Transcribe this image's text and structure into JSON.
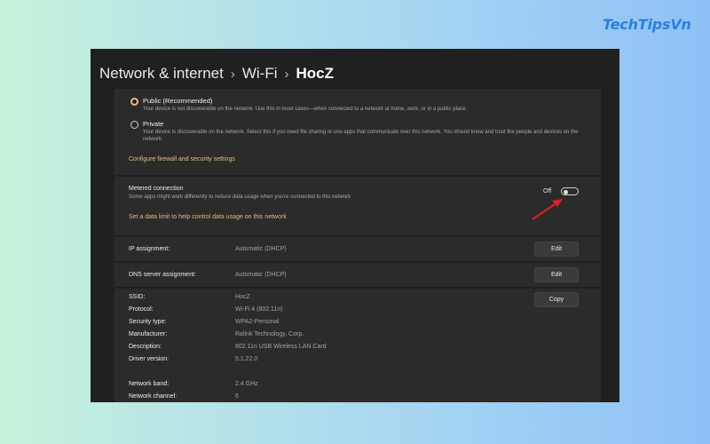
{
  "watermark": "TechTipsVn",
  "breadcrumb": {
    "items": [
      "Network & internet",
      "Wi-Fi",
      "HocZ"
    ],
    "separator": "›"
  },
  "network_profile": {
    "options": [
      {
        "title": "Public (Recommended)",
        "description": "Your device is not discoverable on the network. Use this in most cases—when connected to a network at home, work, or in a public place.",
        "selected": true
      },
      {
        "title": "Private",
        "description": "Your device is discoverable on the network. Select this if you need file sharing or use apps that communicate over this network. You should know and trust the people and devices on the network.",
        "selected": false
      }
    ],
    "firewall_link": "Configure firewall and security settings"
  },
  "metered": {
    "title": "Metered connection",
    "description": "Some apps might work differently to reduce data usage when you're connected to this network",
    "toggle_state": "Off",
    "toggle_on": false,
    "data_limit_link": "Set a data limit to help control data usage on this network"
  },
  "ip_assignment": {
    "label": "IP assignment:",
    "value": "Automatic (DHCP)",
    "button": "Edit"
  },
  "dns_assignment": {
    "label": "DNS server assignment:",
    "value": "Automatic (DHCP)",
    "button": "Edit"
  },
  "properties": {
    "copy_button": "Copy",
    "rows": [
      {
        "label": "SSID:",
        "value": "HocZ"
      },
      {
        "label": "Protocol:",
        "value": "Wi-Fi 4 (802.11n)"
      },
      {
        "label": "Security type:",
        "value": "WPA2-Personal"
      },
      {
        "label": "Manufacturer:",
        "value": "Ralink Technology, Corp."
      },
      {
        "label": "Description:",
        "value": "802.11n USB Wireless LAN Card"
      },
      {
        "label": "Driver version:",
        "value": "5.1.22.0"
      }
    ],
    "extra_rows": [
      {
        "label": "Network band:",
        "value": "2.4 GHz"
      },
      {
        "label": "Network channel:",
        "value": "6"
      }
    ]
  },
  "colors": {
    "accent": "#e2c07a",
    "annotation_arrow": "#e02020",
    "watermark": "#2b7fe0"
  }
}
